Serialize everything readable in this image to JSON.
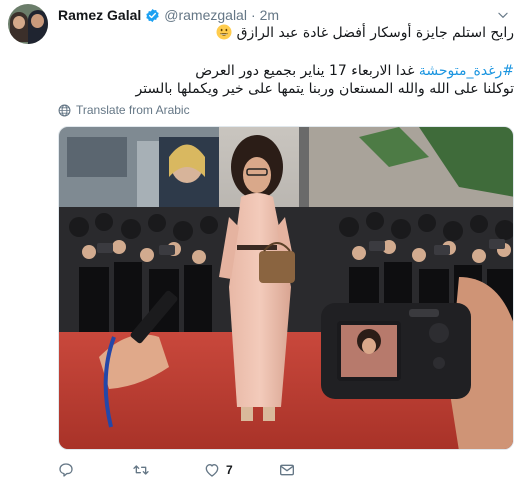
{
  "tweet": {
    "display_name": "Ramez Galal",
    "handle": "@ramezgalal",
    "separator": "·",
    "time": "2m",
    "line1_text": "رايح استلم جايزة أوسكار أفضل غادة عبد الرازق",
    "line1_emoji": "grinning-face-emoji",
    "hashtag": "#رغدة_متوحشة",
    "line2_text": "غدا الاربعاء 17 يناير بجميع دور العرض",
    "line3_text": "توكلنا على الله والله المستعان وربنا يتمها على خير ويكملها بالستر",
    "translate_label": "Translate from Arabic",
    "like_count": "7",
    "verified_color": "#1da1f2",
    "link_color": "#1b95e0",
    "meta_color": "#657786"
  },
  "icons": {
    "reply": "reply-icon",
    "retweet": "retweet-icon",
    "like": "heart-icon",
    "dm": "envelope-icon",
    "caret": "chevron-down-icon",
    "globe": "globe-icon",
    "verified": "verified-badge-icon"
  }
}
